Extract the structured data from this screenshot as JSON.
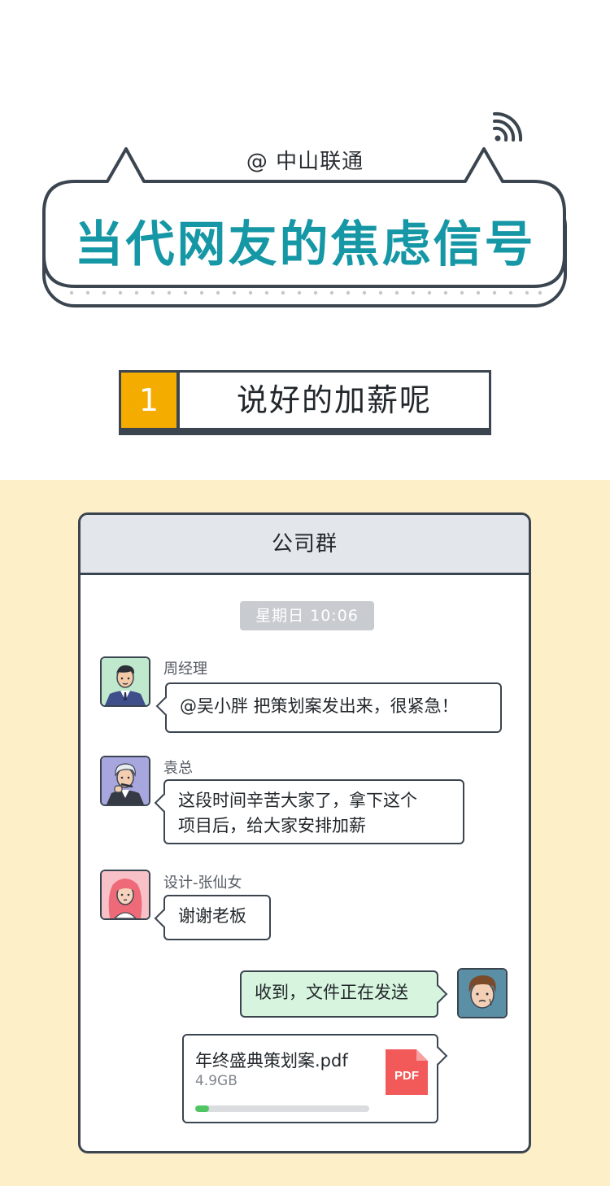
{
  "banner": {
    "handle": "@ 中山联通",
    "title": "当代网友的焦虑信号"
  },
  "section": {
    "number": "1",
    "title": "说好的加薪呢"
  },
  "chat": {
    "window_title": "公司群",
    "timestamp": "星期日   10:06",
    "messages": [
      {
        "sender": "周经理",
        "text": "@吴小胖  把策划案发出来，很紧急！"
      },
      {
        "sender": "袁总",
        "lines": [
          "这段时间辛苦大家了，拿下这个",
          "项目后，给大家安排加薪"
        ]
      },
      {
        "sender": "设计-张仙女",
        "text": "谢谢老板"
      },
      {
        "sender": "",
        "text": "收到，文件正在发送"
      }
    ],
    "file": {
      "name": "年终盛典策划案.pdf",
      "size": "4.9GB",
      "icon_label": "PDF",
      "progress_percent": 8
    }
  },
  "colors": {
    "title_teal": "#1697a6",
    "accent_yellow": "#f5ac00",
    "outline": "#3b4550",
    "chat_background": "#fdefc8",
    "sent_bubble": "#d7f5de",
    "progress_green": "#4fc662",
    "pdf_red": "#f25a5a"
  },
  "icons": [
    "signal-icon",
    "pdf-file-icon"
  ]
}
